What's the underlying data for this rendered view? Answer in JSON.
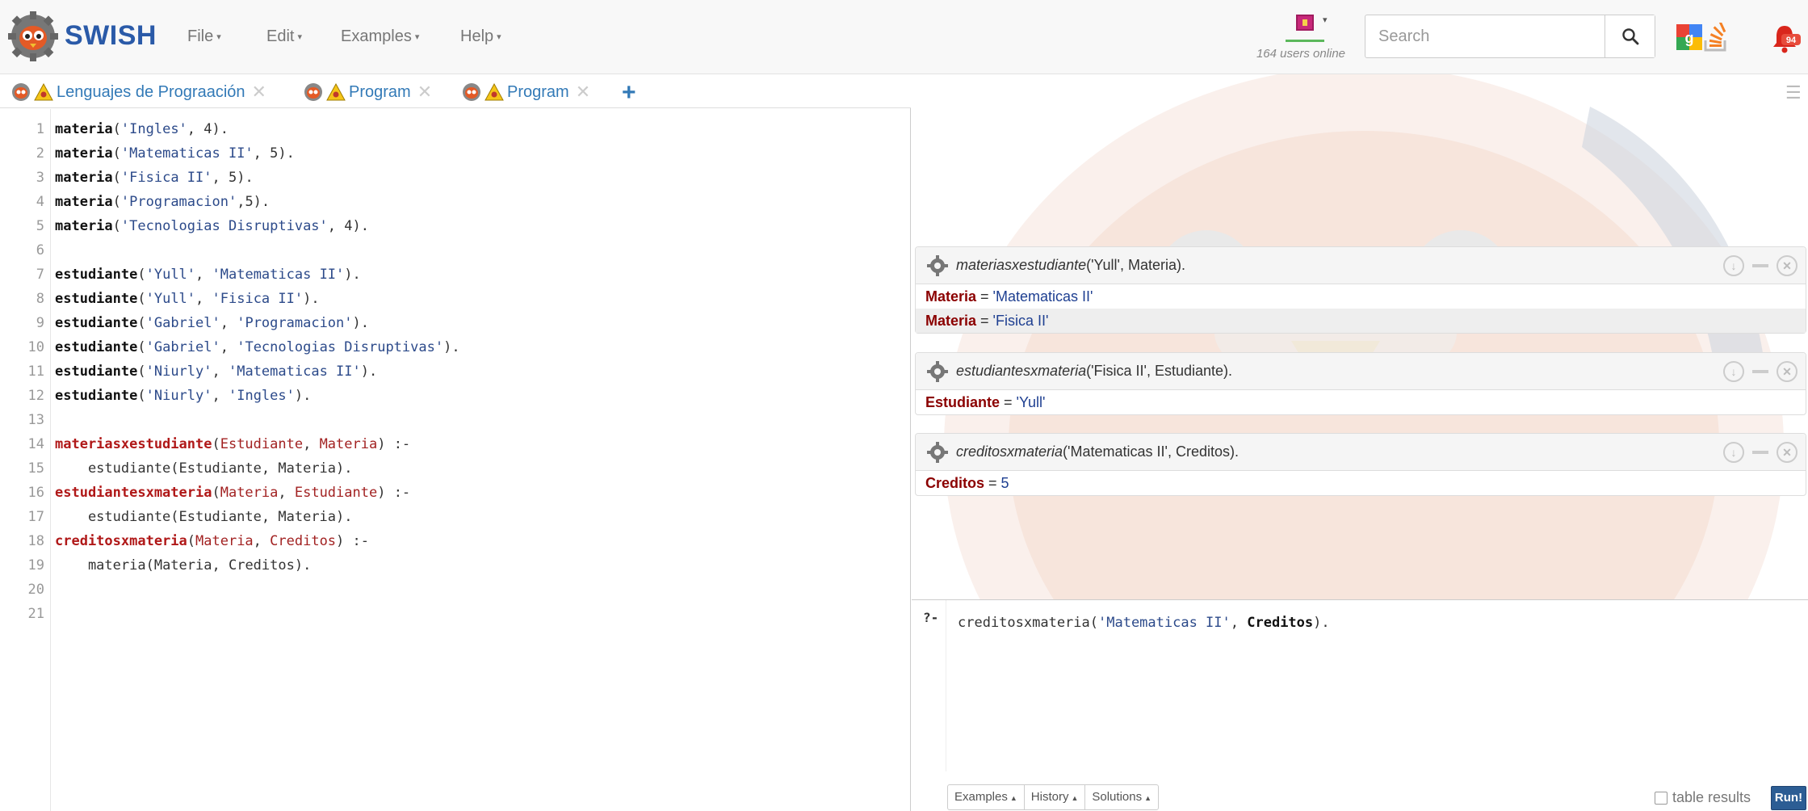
{
  "navbar": {
    "brand": "SWISH",
    "menus": [
      {
        "label": "File"
      },
      {
        "label": "Edit"
      },
      {
        "label": "Examples"
      },
      {
        "label": "Help"
      }
    ],
    "users_online": "164 users online",
    "search_placeholder": "Search",
    "notification_count": "94"
  },
  "tabs": [
    {
      "label": "Lenguajes de Prograación"
    },
    {
      "label": "Program"
    },
    {
      "label": "Program"
    }
  ],
  "editor": {
    "lines": [
      {
        "n": "1"
      },
      {
        "n": "2"
      },
      {
        "n": "3"
      },
      {
        "n": "4"
      },
      {
        "n": "5"
      },
      {
        "n": "6"
      },
      {
        "n": "7"
      },
      {
        "n": "8"
      },
      {
        "n": "9"
      },
      {
        "n": "10"
      },
      {
        "n": "11"
      },
      {
        "n": "12"
      },
      {
        "n": "13"
      },
      {
        "n": "14"
      },
      {
        "n": "15"
      },
      {
        "n": "16"
      },
      {
        "n": "17"
      },
      {
        "n": "18"
      },
      {
        "n": "19"
      },
      {
        "n": "20"
      },
      {
        "n": "21"
      }
    ],
    "code": {
      "l1": [
        "materia",
        "(",
        "'Ingles'",
        ", 4)."
      ],
      "l2": [
        "materia",
        "(",
        "'Matematicas II'",
        ", 5)."
      ],
      "l3": [
        "materia",
        "(",
        "'Fisica II'",
        ", 5)."
      ],
      "l4": [
        "materia",
        "(",
        "'Programacion'",
        ",5)."
      ],
      "l5": [
        "materia",
        "(",
        "'Tecnologias Disruptivas'",
        ", 4)."
      ],
      "l7": [
        "estudiante",
        "(",
        "'Yull'",
        ", ",
        "'Matematicas II'",
        ")."
      ],
      "l8": [
        "estudiante",
        "(",
        "'Yull'",
        ", ",
        "'Fisica II'",
        ")."
      ],
      "l9": [
        "estudiante",
        "(",
        "'Gabriel'",
        ", ",
        "'Programacion'",
        ")."
      ],
      "l10": [
        "estudiante",
        "(",
        "'Gabriel'",
        ", ",
        "'Tecnologias Disruptivas'",
        ")."
      ],
      "l11": [
        "estudiante",
        "(",
        "'Niurly'",
        ", ",
        "'Matematicas II'",
        ")."
      ],
      "l12": [
        "estudiante",
        "(",
        "'Niurly'",
        ", ",
        "'Ingles'",
        ")."
      ],
      "l14": [
        "materiasxestudiante",
        "(",
        "Estudiante",
        ", ",
        "Materia",
        ") :-"
      ],
      "l15": [
        "    estudiante(",
        "Estudiante",
        ", ",
        "Materia",
        ")."
      ],
      "l16": [
        "estudiantesxmateria",
        "(",
        "Materia",
        ", ",
        "Estudiante",
        ") :-"
      ],
      "l17": [
        "    estudiante(",
        "Estudiante",
        ", ",
        "Materia",
        ")."
      ],
      "l18": [
        "creditosxmateria",
        "(",
        "Materia",
        ", ",
        "Creditos",
        ") :-"
      ],
      "l19": [
        "    materia(",
        "Materia",
        ", ",
        "Creditos",
        ")."
      ]
    }
  },
  "answers": [
    {
      "pred": "materiasxestudiante",
      "args": "('Yull', Materia).",
      "rows": [
        {
          "var": "Materia",
          "eq": " = ",
          "val": "'Matematicas II'"
        },
        {
          "var": "Materia",
          "eq": " = ",
          "val": "'Fisica II'"
        }
      ]
    },
    {
      "pred": "estudiantesxmateria",
      "args": "('Fisica II', Estudiante).",
      "rows": [
        {
          "var": "Estudiante",
          "eq": " = ",
          "val": "'Yull'"
        }
      ]
    },
    {
      "pred": "creditosxmateria",
      "args": "('Matematicas II', Creditos).",
      "rows": [
        {
          "var": "Creditos",
          "eq": " = ",
          "val": "5"
        }
      ]
    }
  ],
  "query": {
    "prompt": "?-",
    "parts": [
      "creditosxmateria(",
      "'Matematicas II'",
      ", ",
      "Creditos",
      ")."
    ],
    "buttons": [
      {
        "label": "Examples"
      },
      {
        "label": "History"
      },
      {
        "label": "Solutions"
      }
    ],
    "table_results_label": "table results",
    "run_label": "Run!"
  },
  "colors": {
    "brand": "#2a5aa8",
    "link": "#337ab7",
    "answer_var": "#8b0000",
    "answer_val": "#1e3f91",
    "run_button": "#2c5d94"
  }
}
